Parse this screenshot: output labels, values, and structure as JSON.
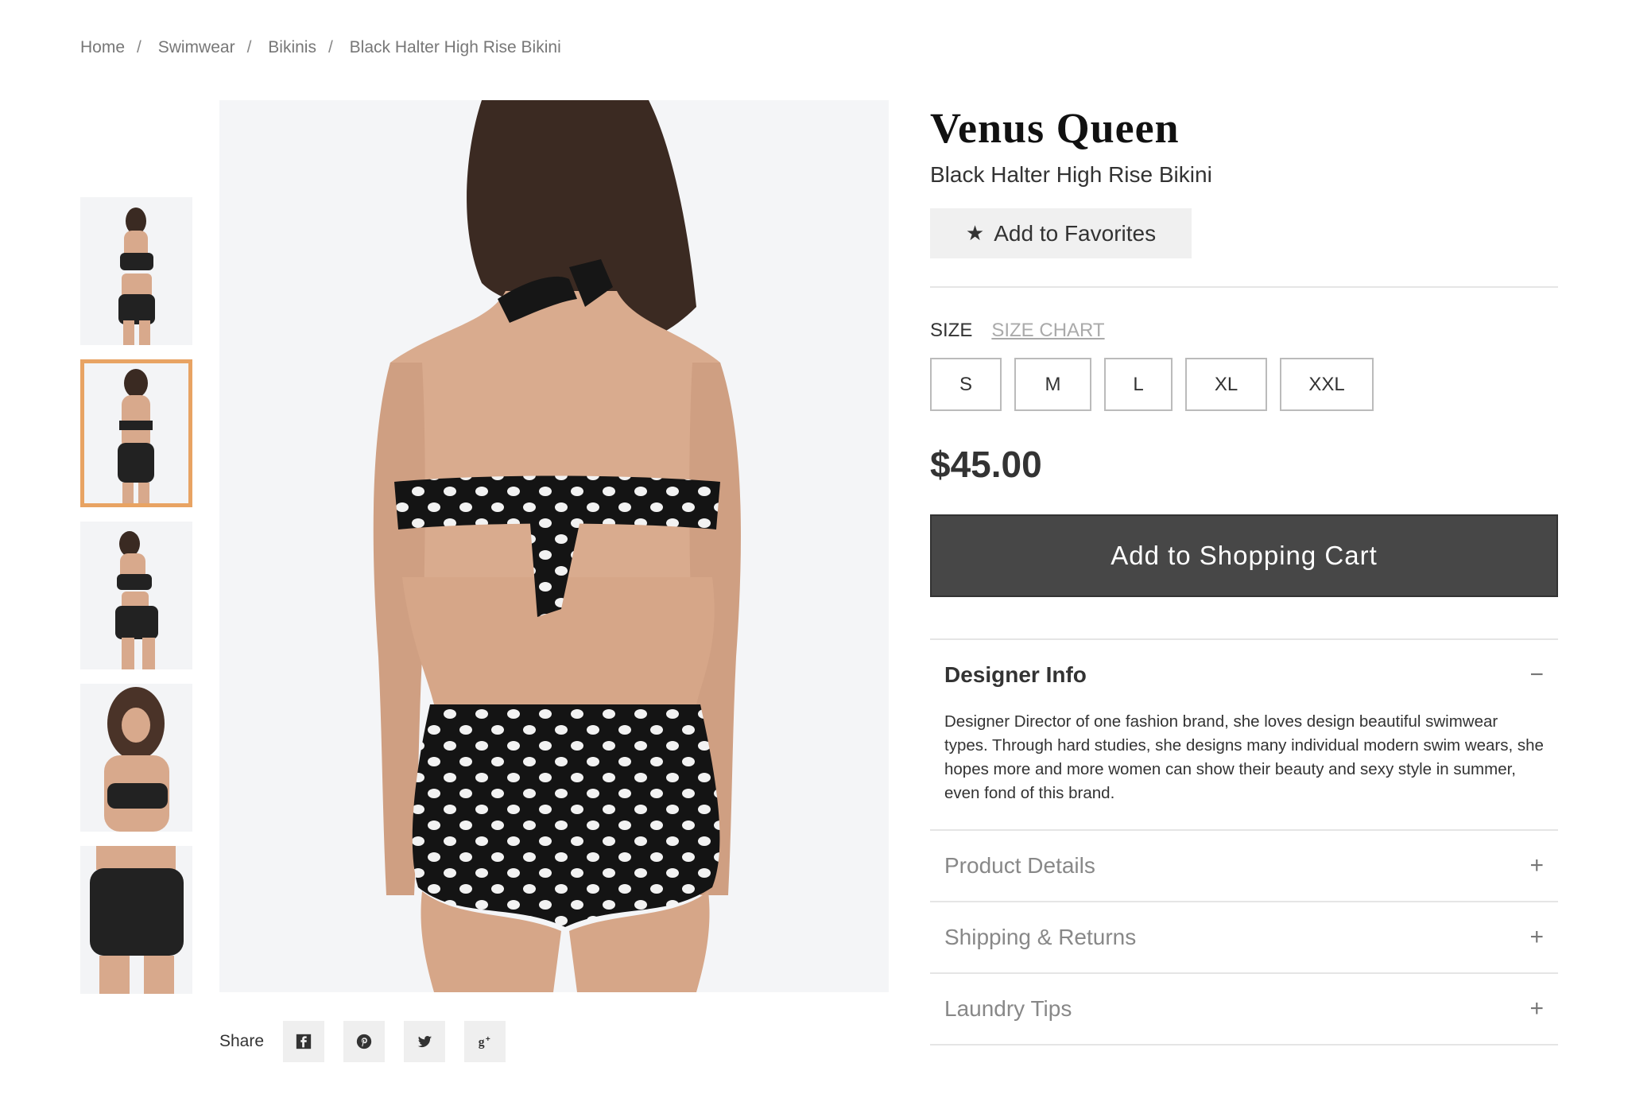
{
  "breadcrumb": [
    "Home",
    "Swimwear",
    "Bikinis",
    "Black Halter High Rise Bikini"
  ],
  "product": {
    "brand": "Venus Queen",
    "name": "Black Halter High Rise Bikini",
    "favorites_label": "Add to Favorites",
    "size_label": "SIZE",
    "size_chart_label": "SIZE CHART",
    "sizes": [
      "S",
      "M",
      "L",
      "XL",
      "XXL"
    ],
    "price": "$45.00",
    "cart_label": "Add to Shopping Cart"
  },
  "accordion": [
    {
      "title": "Designer Info",
      "open": true,
      "toggle": "−",
      "body": "Designer Director of one fashion brand, she loves design beautiful swimwear types. Through hard studies, she designs many individual modern swim wears, she hopes more and more women can show their beauty and sexy style in summer, even fond of this brand."
    },
    {
      "title": "Product Details",
      "open": false,
      "toggle": "+"
    },
    {
      "title": "Shipping & Returns",
      "open": false,
      "toggle": "+"
    },
    {
      "title": "Laundry Tips",
      "open": false,
      "toggle": "+"
    }
  ],
  "share": {
    "label": "Share",
    "icons": [
      "facebook-icon",
      "pinterest-icon",
      "twitter-icon",
      "google-plus-icon"
    ]
  },
  "gallery": {
    "thumbnail_count": 5,
    "active_index": 1
  },
  "colors": {
    "accent_border": "#e8a363",
    "cart_button": "#474747"
  }
}
